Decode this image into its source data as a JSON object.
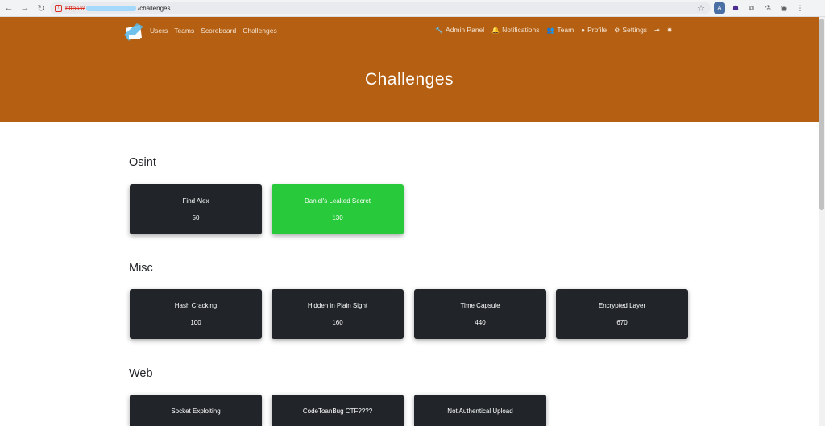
{
  "browser": {
    "url_scheme": "https://",
    "url_path": "/challenges",
    "icons": [
      "back-arrow-icon",
      "forward-arrow-icon",
      "reload-icon",
      "star-icon",
      "extensions-icon",
      "profile-icon",
      "menu-icon"
    ]
  },
  "nav": {
    "left": [
      {
        "label": "Users"
      },
      {
        "label": "Teams"
      },
      {
        "label": "Scoreboard"
      },
      {
        "label": "Challenges"
      }
    ],
    "right": [
      {
        "label": "Admin Panel",
        "icon": "wrench-icon"
      },
      {
        "label": "Notifications",
        "icon": "bell-icon"
      },
      {
        "label": "Team",
        "icon": "users-icon"
      },
      {
        "label": "Profile",
        "icon": "user-circle-icon"
      },
      {
        "label": "Settings",
        "icon": "cogs-icon"
      }
    ]
  },
  "page": {
    "title": "Challenges"
  },
  "colors": {
    "header": "#b45f12",
    "card": "#212529",
    "solved": "#28c93a"
  },
  "categories": [
    {
      "name": "Osint",
      "challenges": [
        {
          "name": "Find Alex",
          "points": "50",
          "solved": false
        },
        {
          "name": "Daniel's Leaked Secret",
          "points": "130",
          "solved": true
        }
      ]
    },
    {
      "name": "Misc",
      "challenges": [
        {
          "name": "Hash Cracking",
          "points": "100",
          "solved": false
        },
        {
          "name": "Hidden in Plain Sight",
          "points": "160",
          "solved": false
        },
        {
          "name": "Time Capsule",
          "points": "440",
          "solved": false
        },
        {
          "name": "Encrypted Layer",
          "points": "670",
          "solved": false
        }
      ]
    },
    {
      "name": "Web",
      "challenges": [
        {
          "name": "Socket Exploiting",
          "points": "",
          "solved": false
        },
        {
          "name": "CodeToanBug CTF????",
          "points": "",
          "solved": false
        },
        {
          "name": "Not Authentical Upload",
          "points": "",
          "solved": false
        }
      ]
    }
  ]
}
